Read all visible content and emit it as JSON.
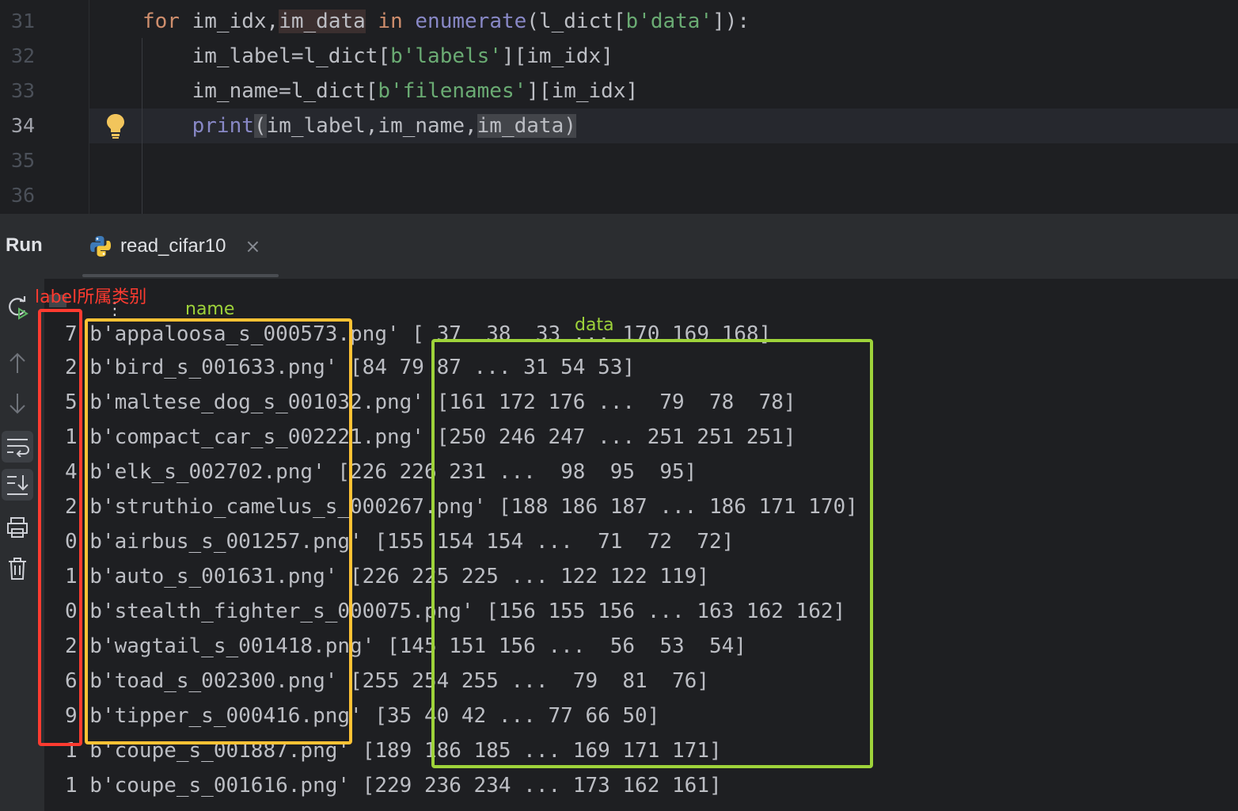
{
  "editor": {
    "lines": [
      {
        "num": "31"
      },
      {
        "num": "32"
      },
      {
        "num": "33"
      },
      {
        "num": "34"
      },
      {
        "num": "35"
      },
      {
        "num": "36"
      }
    ],
    "code": {
      "line31": {
        "kw_for": "for",
        "t1": " im_idx,",
        "hl_var": "im_data",
        "kw_in": " in ",
        "fn_enum": "enumerate",
        "t2": "(l_dict[",
        "str": "b'data'",
        "t3": "]):"
      },
      "line32": {
        "t1": "    im_label=l_dict[",
        "str": "b'labels'",
        "t2": "][im_idx]"
      },
      "line33": {
        "t1": "    im_name=l_dict[",
        "str": "b'filenames'",
        "t2": "][im_idx]"
      },
      "line34": {
        "fn_print": "    print",
        "t1": "(",
        "t2": "im_label,im_name,",
        "t3": "im_data",
        "t4": ")"
      }
    }
  },
  "run": {
    "title": "Run",
    "tab_label": "read_cifar10",
    "tab_close": "×",
    "kebab": "⋮"
  },
  "console": {
    "lines": [
      "7 b'appaloosa_s_000573.png' [ 37  38  33 ... 170 169 168]",
      "2 b'bird_s_001633.png' [84 79 87 ... 31 54 53]",
      "5 b'maltese_dog_s_001032.png' [161 172 176 ...  79  78  78]",
      "1 b'compact_car_s_002221.png' [250 246 247 ... 251 251 251]",
      "4 b'elk_s_002702.png' [226 226 231 ...  98  95  95]",
      "2 b'struthio_camelus_s_000267.png' [188 186 187 ... 186 171 170]",
      "0 b'airbus_s_001257.png' [155 154 154 ...  71  72  72]",
      "1 b'auto_s_001631.png' [226 225 225 ... 122 122 119]",
      "0 b'stealth_fighter_s_000075.png' [156 155 156 ... 163 162 162]",
      "2 b'wagtail_s_001418.png' [145 151 156 ...  56  53  54]",
      "6 b'toad_s_002300.png' [255 254 255 ...  79  81  76]",
      "9 b'tipper_s_000416.png' [35 40 42 ... 77 66 50]",
      "1 b'coupe_s_001887.png' [189 186 185 ... 169 171 171]",
      "1 b'coupe_s_001616.png' [229 236 234 ... 173 162 161]"
    ]
  },
  "annotations": {
    "label_text": "label所属类别",
    "name_text": "name",
    "data_text": "data",
    "colors": {
      "label": "#ff3b30",
      "name": "#ffc234",
      "data": "#9ed33a"
    }
  },
  "sidebar_icons": [
    "rerun-icon",
    "scroll-up-icon",
    "scroll-down-icon",
    "soft-wrap-icon",
    "scroll-to-end-icon",
    "print-icon",
    "trash-icon"
  ]
}
